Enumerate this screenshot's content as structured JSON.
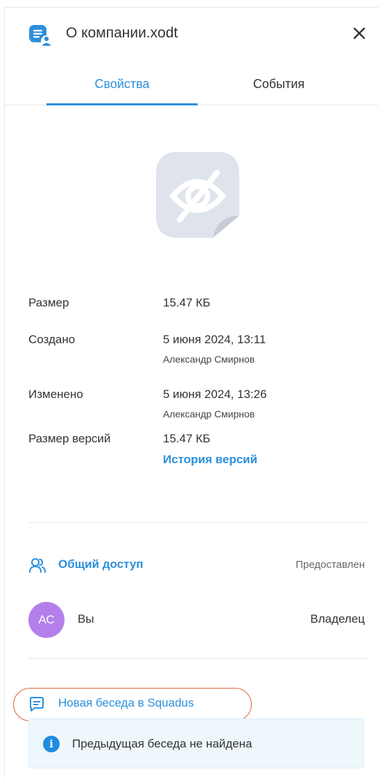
{
  "header": {
    "title": "О компании.xodt",
    "app_icon": "document-user-icon",
    "close_icon": "close-icon"
  },
  "tabs": [
    {
      "label": "Свойства",
      "active": true
    },
    {
      "label": "События",
      "active": false
    }
  ],
  "preview": {
    "icon": "hidden-eye-icon"
  },
  "properties": {
    "size_label": "Размер",
    "size_value": "15.47 КБ",
    "created_label": "Создано",
    "created_value": "5 июня 2024, 13:11",
    "created_by": "Александр Смирнов",
    "modified_label": "Изменено",
    "modified_value": "5 июня 2024, 13:26",
    "modified_by": "Александр Смирнов",
    "versions_label": "Размер версий",
    "versions_value": "15.47 КБ",
    "versions_link": "История версий"
  },
  "sharing": {
    "label": "Общий доступ",
    "status": "Предоставлен",
    "icon": "users-icon",
    "users": [
      {
        "initials": "АС",
        "name": "Вы",
        "role": "Владелец"
      }
    ]
  },
  "chat": {
    "link": "Новая беседа в Squadus",
    "icon": "chat-icon",
    "notice": "Предыдущая беседа не найдена",
    "notice_icon": "info-icon"
  },
  "colors": {
    "accent": "#2c8fdb",
    "avatar": "#b37feb",
    "highlight_oval": "#d9623d",
    "notice_bg": "#eef7fc"
  }
}
